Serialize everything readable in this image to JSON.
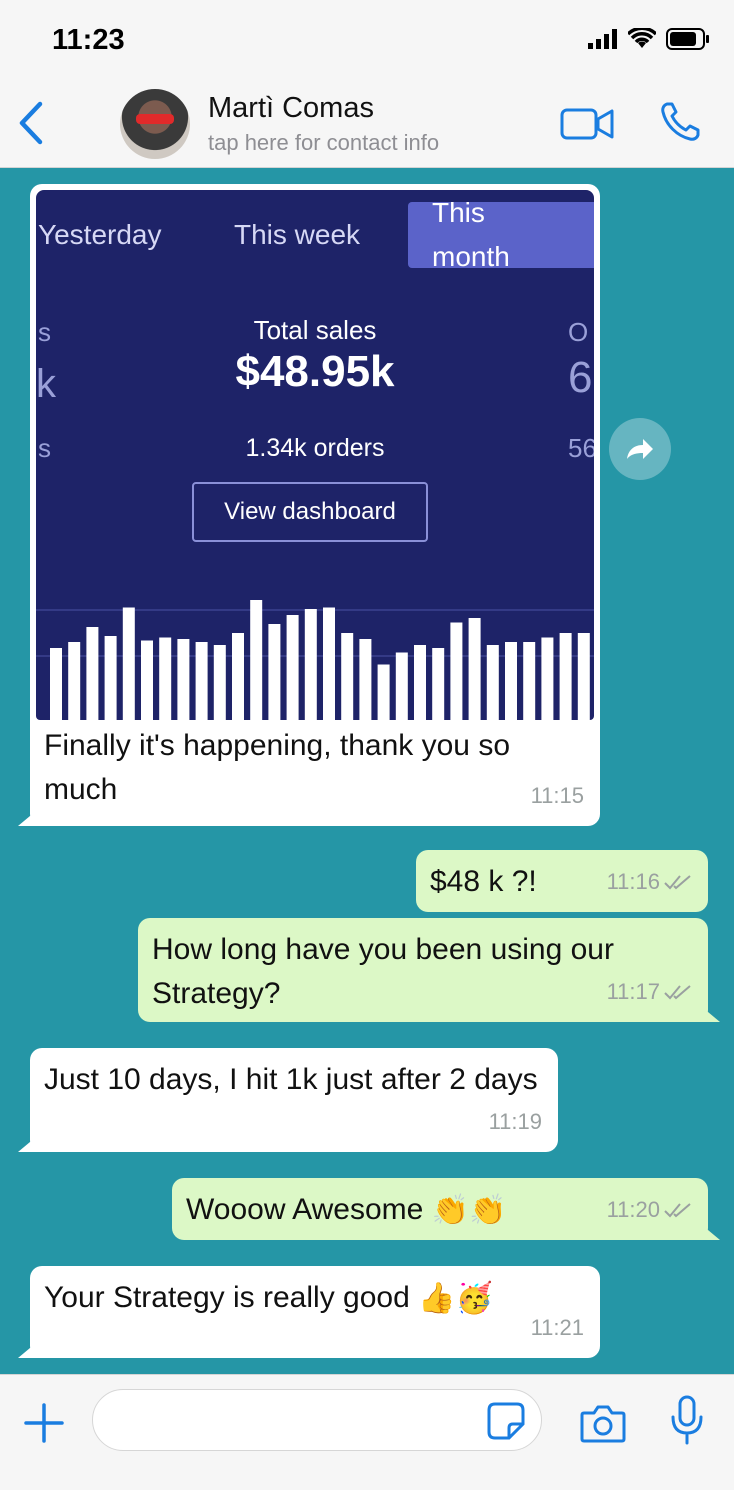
{
  "status_bar": {
    "time": "11:23",
    "icons": [
      "signal-icon",
      "wifi-icon",
      "battery-icon"
    ]
  },
  "header": {
    "name": "Martì Comas",
    "subtitle": "tap here for contact info",
    "icons": [
      "back-chevron-icon",
      "video-call-icon",
      "phone-icon"
    ]
  },
  "colors": {
    "accent": "#1a7de0",
    "chat_bg": "#2596a6",
    "outgoing": "#dcf8c6",
    "incoming": "#ffffff",
    "card_bg": "#1e2368"
  },
  "screenshot_card": {
    "tabs": [
      "Yesterday",
      "This week",
      "This month"
    ],
    "active_tab": "This month",
    "edge_left": [
      "s",
      "k",
      "s"
    ],
    "edge_right": [
      "O",
      "6",
      "56"
    ],
    "total_label": "Total sales",
    "total_value": "$48.95k",
    "orders": "1.34k orders",
    "button": "View dashboard",
    "bar_values": [
      0.48,
      0.52,
      0.62,
      0.56,
      0.75,
      0.53,
      0.55,
      0.54,
      0.52,
      0.5,
      0.58,
      0.8,
      0.64,
      0.7,
      0.74,
      0.75,
      0.58,
      0.54,
      0.37,
      0.45,
      0.5,
      0.48,
      0.65,
      0.68,
      0.5,
      0.52,
      0.52,
      0.55,
      0.58,
      0.58
    ]
  },
  "messages": [
    {
      "dir": "in",
      "text": "Finally it's happening, thank you so much",
      "time": "11:15"
    },
    {
      "dir": "out",
      "text": "$48 k ?!",
      "time": "11:16"
    },
    {
      "dir": "out",
      "text": "How long have you been using our Strategy?",
      "time": "11:17"
    },
    {
      "dir": "in",
      "text": "Just 10 days, I hit 1k just after 2 days",
      "time": "11:19"
    },
    {
      "dir": "out",
      "text": "Wooow Awesome",
      "emoji": "👏👏",
      "time": "11:20"
    },
    {
      "dir": "in",
      "text": "Your Strategy is really good",
      "emoji": "👍🥳",
      "time": "11:21"
    }
  ]
}
